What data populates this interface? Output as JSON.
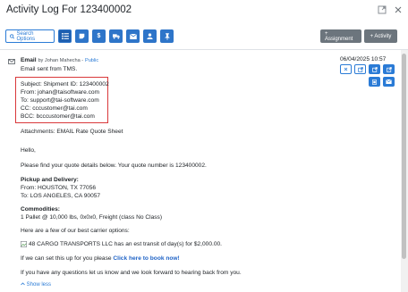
{
  "header": {
    "title": "Activity Log For 123400002"
  },
  "toolbar": {
    "search_label": "Search Options",
    "assignment_label": "+ Assignment",
    "activity_label": "+ Activity"
  },
  "entry": {
    "type": "Email",
    "by": "by Johan Mahecha -",
    "source_link": "Public",
    "summary": "Email sent from TMS.",
    "timestamp": "06/04/2025 10:57",
    "subject": "Subject: Shipment ID: 123400002",
    "from": "From: johan@taisoftware.com",
    "to": "To: support@tai-software.com",
    "cc": "CC: cccustomer@tai.com",
    "bcc": "BCC: bcccustomer@tai.com",
    "attachments": "Attachments: EMAIL Rate Quote Sheet",
    "hello": "Hello,",
    "quote_line": "Please find your quote details below. Your quote number is 123400002.",
    "pickup_heading": "Pickup and Delivery:",
    "pickup_from": "From: HOUSTON, TX 77056",
    "pickup_to": "To: LOS ANGELES, CA 90057",
    "commodities_heading": "Commodities:",
    "commodities_line": "1 Pallet @ 10,000 lbs, 0x0x0, Freight (class No Class)",
    "carrier_intro": "Here are a few of our best carrier options:",
    "carrier_option": "48 CARGO TRANSPORTS LLC has an est transit of day(s) for $2,000.00.",
    "book_prefix": "If we can set this up for you please",
    "book_link": "Click here to book now!",
    "questions_line": "If you have any questions let us know and we look forward to hearing back from you.",
    "show_less": "Show less"
  },
  "colors": {
    "primary": "#2a7bd6",
    "gray_button": "#6c757d",
    "highlight_border": "#d9383a"
  },
  "icons": [
    "envelope-icon",
    "expand-icon",
    "close-icon",
    "search-icon",
    "list-icon",
    "note-icon",
    "dollar-icon",
    "truck-icon",
    "mail-icon",
    "person-icon",
    "pin-icon",
    "x-icon",
    "external-link-icon",
    "share-icon",
    "copy-icon",
    "reply-icon",
    "chevron-up-icon",
    "broken-image-icon"
  ]
}
